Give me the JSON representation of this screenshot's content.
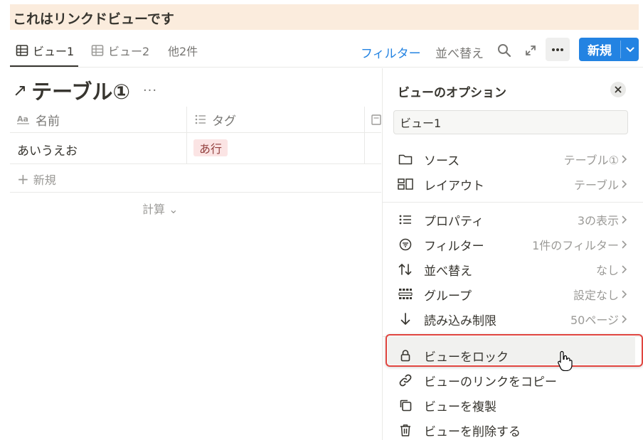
{
  "banner": {
    "text": "これはリンクドビューです"
  },
  "tabs": [
    {
      "label": "ビュー1",
      "icon": "table-icon",
      "active": true
    },
    {
      "label": "ビュー2",
      "icon": "table-icon",
      "active": false
    },
    {
      "label": "他2件",
      "icon": "",
      "active": false
    }
  ],
  "toolbar": {
    "filter": "フィルター",
    "sort": "並べ替え",
    "search_icon": "search-icon",
    "expand_icon": "expand-icon",
    "more_icon": "more-icon",
    "new_label": "新規",
    "accent": "#2383e2"
  },
  "table": {
    "title_arrow": "↗",
    "title": "テーブル①",
    "menu": "···",
    "columns": [
      {
        "icon": "text-property-icon",
        "label": "名前"
      },
      {
        "icon": "list-property-icon",
        "label": "タグ"
      }
    ],
    "rows": [
      {
        "name": "あいうえお",
        "tag": "あ行"
      }
    ],
    "new_row": "新規",
    "calc": "計算 ⌄"
  },
  "panel": {
    "title": "ビューのオプション",
    "view_name": "ビュー1",
    "group1": [
      {
        "icon": "folder-icon",
        "label": "ソース",
        "value": "テーブル①"
      },
      {
        "icon": "layout-icon",
        "label": "レイアウト",
        "value": "テーブル"
      }
    ],
    "group2": [
      {
        "icon": "list-icon",
        "label": "プロパティ",
        "value": "3の表示"
      },
      {
        "icon": "filter-icon",
        "label": "フィルター",
        "value": "1件のフィルター"
      },
      {
        "icon": "sort-icon",
        "label": "並べ替え",
        "value": "なし"
      },
      {
        "icon": "group-icon",
        "label": "グループ",
        "value": "設定なし"
      },
      {
        "icon": "arrow-down-icon",
        "label": "読み込み制限",
        "value": "50ページ"
      }
    ],
    "group3": [
      {
        "icon": "lock-icon",
        "label": "ビューをロック"
      },
      {
        "icon": "link-icon",
        "label": "ビューのリンクをコピー"
      },
      {
        "icon": "duplicate-icon",
        "label": "ビューを複製"
      },
      {
        "icon": "trash-icon",
        "label": "ビューを削除する"
      }
    ],
    "highlight_color": "#e0453f"
  }
}
